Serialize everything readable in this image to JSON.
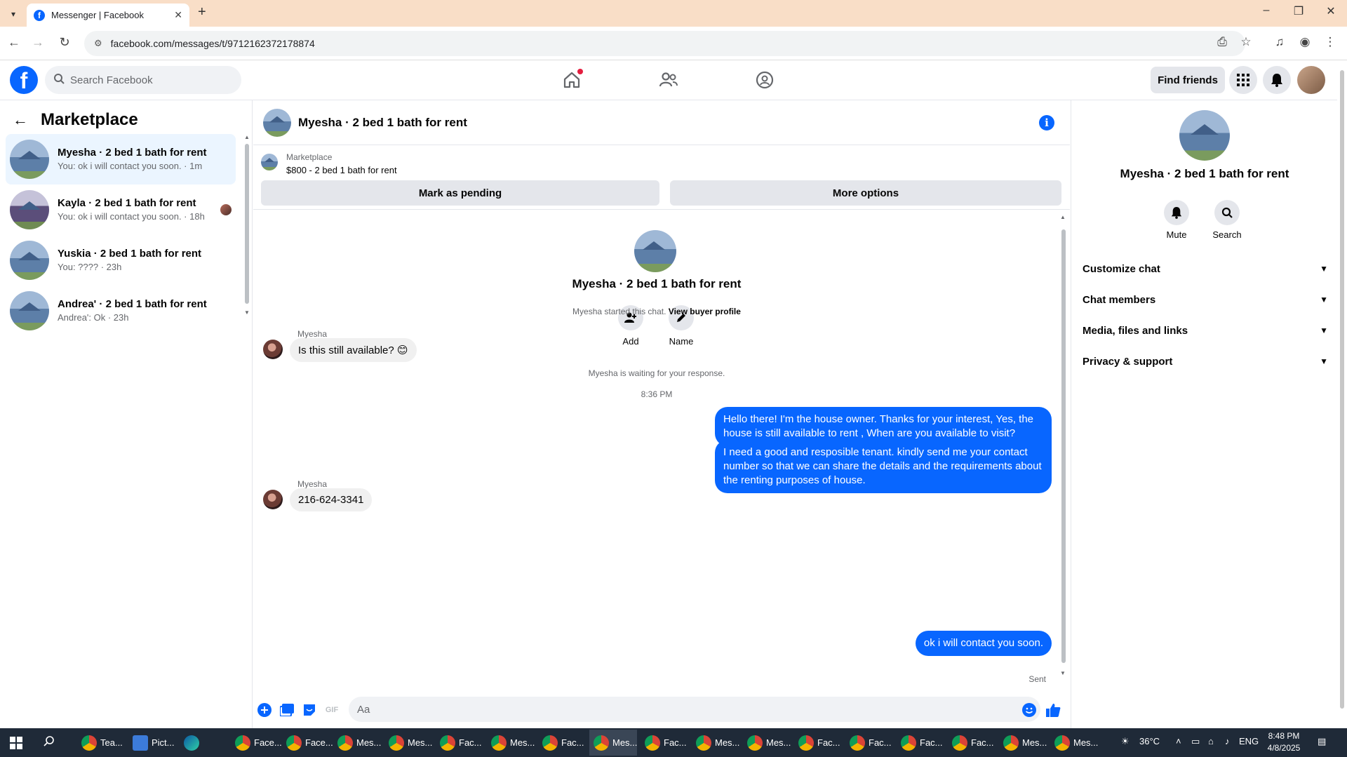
{
  "browser": {
    "tab_title": "Messenger | Facebook",
    "url": "facebook.com/messages/t/9712162372178874"
  },
  "facebook": {
    "search_placeholder": "Search Facebook",
    "find_friends_label": "Find friends"
  },
  "sidebar": {
    "title": "Marketplace",
    "conversations": [
      {
        "name": "Myesha · 2 bed 1 bath for rent",
        "snippet": "You: ok i will contact you soon. · 1m",
        "active": true
      },
      {
        "name": "Kayla · 2 bed 1 bath for rent",
        "snippet": "You: ok i will contact you soon. · 18h",
        "active": false
      },
      {
        "name": "Yuskia · 2 bed 1 bath for rent",
        "snippet": "You: ???? · 23h",
        "active": false
      },
      {
        "name": "Andrea' · 2 bed 1 bath for rent",
        "snippet": "Andrea': Ok · 23h",
        "active": false
      }
    ]
  },
  "chat": {
    "title": "Myesha · 2 bed 1 bath for rent",
    "marketplace_label": "Marketplace",
    "listing": "$800 - 2 bed 1 bath for rent",
    "mark_pending_label": "Mark as pending",
    "more_options_label": "More options",
    "intro_name": "Myesha · 2 bed 1 bath for rent",
    "add_label": "Add",
    "name_label": "Name",
    "started_text": "Myesha started this chat.",
    "view_buyer_profile": "View buyer profile",
    "waiting_text": "Myesha is waiting for your response.",
    "timestamp": "8:36 PM",
    "messages": [
      {
        "sender": "Myesha",
        "text": "Is this still available? 😊"
      },
      {
        "sender": "me",
        "text": "Hello there! I'm the house owner. Thanks for your interest, Yes, the house is still available to rent , When are you available to visit?"
      },
      {
        "sender": "me",
        "text": "I need a good and resposible tenant.  kindly send me your contact number so that we can share the details and the requirements about the renting purposes of house."
      },
      {
        "sender": "Myesha",
        "text": "216-624-3341"
      },
      {
        "sender": "me",
        "text": "ok i will contact you soon."
      }
    ],
    "sent_status": "Sent",
    "composer_placeholder": "Aa"
  },
  "right_panel": {
    "name": "Myesha · 2 bed 1 bath for rent",
    "mute_label": "Mute",
    "search_label": "Search",
    "sections": [
      "Customize chat",
      "Chat members",
      "Media, files and links",
      "Privacy & support"
    ]
  },
  "taskbar": {
    "apps": [
      {
        "label": "Tea...",
        "icon": "chrome"
      },
      {
        "label": "Pict...",
        "icon": "pic"
      },
      {
        "label": "",
        "icon": "edge"
      },
      {
        "label": "Face...",
        "icon": "chrome"
      },
      {
        "label": "Face...",
        "icon": "chrome"
      },
      {
        "label": "Mes...",
        "icon": "chrome"
      },
      {
        "label": "Mes...",
        "icon": "chrome"
      },
      {
        "label": "Fac...",
        "icon": "chrome"
      },
      {
        "label": "Mes...",
        "icon": "chrome"
      },
      {
        "label": "Fac...",
        "icon": "chrome"
      },
      {
        "label": "Mes...",
        "icon": "chrome"
      },
      {
        "label": "Fac...",
        "icon": "chrome"
      },
      {
        "label": "Mes...",
        "icon": "chrome"
      },
      {
        "label": "Mes...",
        "icon": "chrome"
      },
      {
        "label": "Fac...",
        "icon": "chrome"
      },
      {
        "label": "Fac...",
        "icon": "chrome"
      },
      {
        "label": "Fac...",
        "icon": "chrome"
      },
      {
        "label": "Fac...",
        "icon": "chrome"
      },
      {
        "label": "Mes...",
        "icon": "chrome"
      },
      {
        "label": "Mes...",
        "icon": "chrome"
      }
    ],
    "temperature": "36°C",
    "language": "ENG",
    "time": "8:48 PM",
    "date": "4/8/2025"
  },
  "colors": {
    "accent": "#0866ff",
    "tab_bar": "#f9dec7",
    "taskbar": "#1f2a38"
  }
}
